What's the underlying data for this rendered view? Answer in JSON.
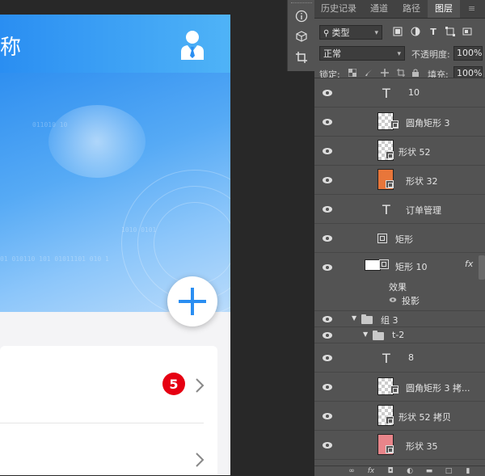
{
  "app": {
    "title": "称",
    "badge_count": "5"
  },
  "banner": {
    "binary_lines": [
      "01 010110 101 01011101 010 1",
      "1010 0101",
      "011010 10"
    ]
  },
  "panel": {
    "tabs": [
      {
        "label": "历史记录",
        "active": false
      },
      {
        "label": "通道",
        "active": false
      },
      {
        "label": "路径",
        "active": false
      },
      {
        "label": "图层",
        "active": true
      }
    ],
    "filter": {
      "kind_label": "类型"
    },
    "blend_mode": "正常",
    "opacity_label": "不透明度:",
    "opacity_value": "100%",
    "lock_label": "锁定:",
    "fill_label": "填充:",
    "fill_value": "100%",
    "layers": [
      {
        "name": "10",
        "type": "text"
      },
      {
        "name": "圆角矩形 3",
        "type": "shape-checker"
      },
      {
        "name": "形状 52",
        "type": "shape-checker"
      },
      {
        "name": "形状 32",
        "type": "shape-orange"
      },
      {
        "name": "订单管理",
        "type": "text"
      },
      {
        "name": "矩形",
        "type": "vector"
      },
      {
        "name": "矩形 10",
        "type": "shape-white",
        "fx": "fx",
        "effects_label": "效果",
        "effect_name": "投影"
      },
      {
        "name": "组 3",
        "type": "group"
      },
      {
        "name": "t-2",
        "type": "group"
      },
      {
        "name": "8",
        "type": "text"
      },
      {
        "name": "圆角矩形 3 拷...",
        "type": "shape-checker"
      },
      {
        "name": "形状 52 拷贝",
        "type": "shape-checker"
      },
      {
        "name": "形状 35",
        "type": "shape-pink"
      }
    ],
    "bottom_icons": [
      "link-icon",
      "fx-icon",
      "mask-icon",
      "adjustment-icon",
      "folder-icon",
      "new-layer-icon",
      "trash-icon"
    ],
    "bottom_fx": "fx"
  },
  "colors": {
    "accent_blue": "#2a8ef2",
    "badge_red": "#e60012",
    "panel_bg": "#535353"
  }
}
